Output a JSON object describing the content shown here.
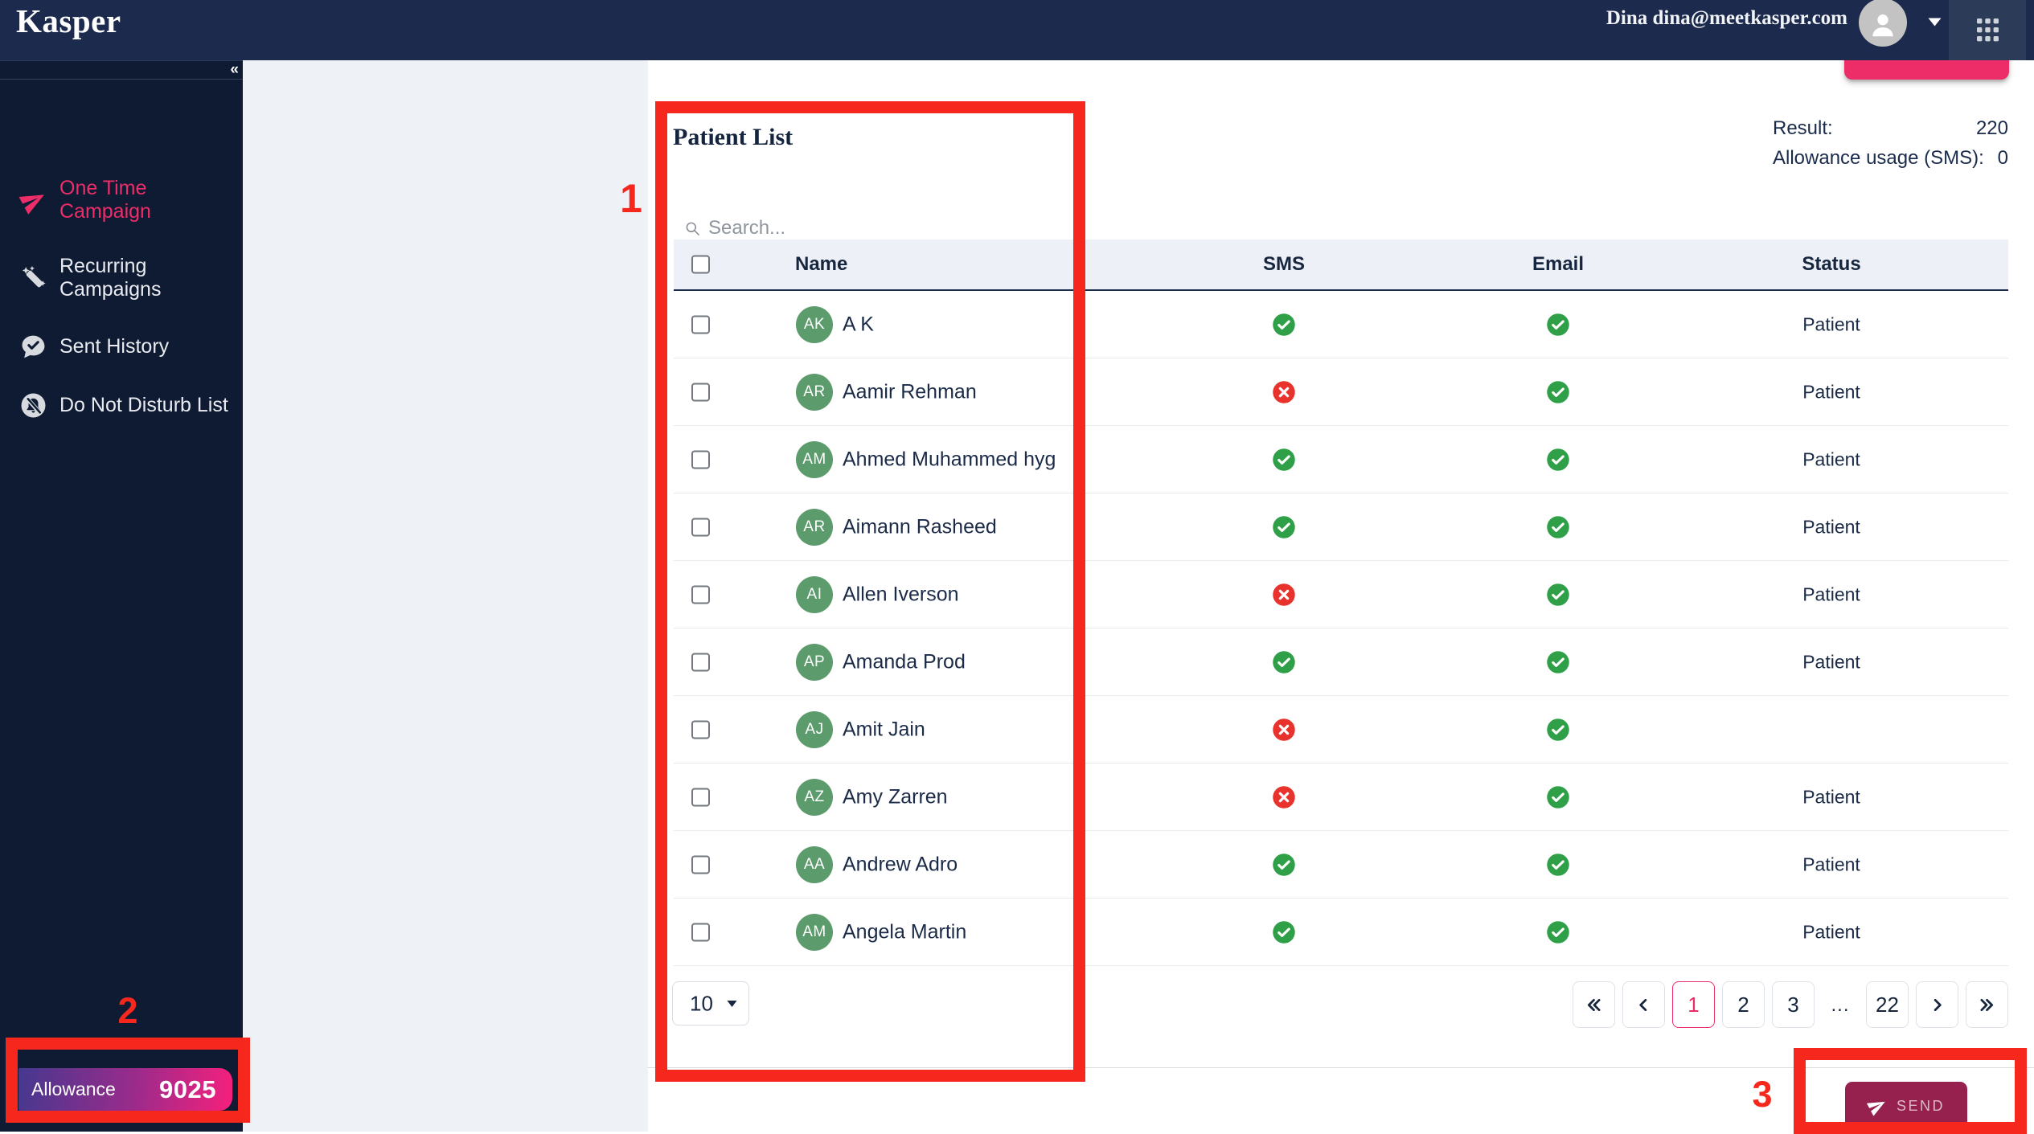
{
  "theme": {
    "header_bg": "#1c2b4d",
    "apps_bg": "#2b3b58",
    "sidebar_bg": "#0e1b33",
    "content_bg": "#eef1f6",
    "thead_bg": "#edf0f6",
    "navy_text": "#16263f",
    "accent_pink": "#ec2d68",
    "annotation_red": "#f6281e",
    "send_bg": "#97214e",
    "avatar_green": "#5c9b6c",
    "check_green": "#2fa048",
    "cancel_red": "#e8332d",
    "grad_start": "#45388f",
    "grad_mid": "#9c2b8b",
    "grad_end": "#f6207c"
  },
  "header": {
    "logo": "Kasper",
    "user": "Dina dina@meetkasper.com"
  },
  "sidebar": {
    "collapse_icon": "«",
    "items": [
      {
        "label": "One Time Campaign",
        "icon": "paper-plane-icon",
        "active": true
      },
      {
        "label": "Recurring Campaigns",
        "icon": "magic-wand-icon",
        "active": false
      },
      {
        "label": "Sent History",
        "icon": "chat-check-icon",
        "active": false
      },
      {
        "label": "Do Not Disturb List",
        "icon": "bell-slash-icon",
        "active": false
      }
    ],
    "allowance": {
      "label": "Allowance",
      "value": "9025"
    }
  },
  "main": {
    "title": "Patient List",
    "stats": [
      {
        "label": "Result:",
        "value": "220"
      },
      {
        "label": "Allowance usage (SMS):",
        "value": "0"
      }
    ],
    "search": {
      "placeholder": "Search..."
    },
    "table": {
      "columns": {
        "name": "Name",
        "sms": "SMS",
        "email": "Email",
        "status": "Status"
      },
      "rows": [
        {
          "initials": "AK",
          "name": "A K",
          "sms": true,
          "email": true,
          "status": "Patient"
        },
        {
          "initials": "AR",
          "name": "Aamir Rehman",
          "sms": false,
          "email": true,
          "status": "Patient"
        },
        {
          "initials": "AM",
          "name": "Ahmed Muhammed hyg",
          "sms": true,
          "email": true,
          "status": "Patient"
        },
        {
          "initials": "AR",
          "name": "Aimann Rasheed",
          "sms": true,
          "email": true,
          "status": "Patient"
        },
        {
          "initials": "AI",
          "name": "Allen Iverson",
          "sms": false,
          "email": true,
          "status": "Patient"
        },
        {
          "initials": "AP",
          "name": "Amanda Prod",
          "sms": true,
          "email": true,
          "status": "Patient"
        },
        {
          "initials": "AJ",
          "name": "Amit Jain",
          "sms": false,
          "email": true,
          "status": ""
        },
        {
          "initials": "AZ",
          "name": "Amy Zarren",
          "sms": false,
          "email": true,
          "status": "Patient"
        },
        {
          "initials": "AA",
          "name": "Andrew Adro",
          "sms": true,
          "email": true,
          "status": "Patient"
        },
        {
          "initials": "AM",
          "name": "Angela Martin",
          "sms": true,
          "email": true,
          "status": "Patient"
        }
      ]
    },
    "pagination": {
      "rows_per_page": "10",
      "items": [
        {
          "kind": "first",
          "icon": "chevrons-left-icon"
        },
        {
          "kind": "prev",
          "icon": "chevron-left-icon"
        },
        {
          "kind": "page",
          "label": "1",
          "active": true
        },
        {
          "kind": "page",
          "label": "2"
        },
        {
          "kind": "page",
          "label": "3"
        },
        {
          "kind": "ellipsis",
          "label": "..."
        },
        {
          "kind": "page",
          "label": "22"
        },
        {
          "kind": "next",
          "icon": "chevron-right-icon"
        },
        {
          "kind": "last",
          "icon": "chevrons-right-icon"
        }
      ]
    },
    "send_label": "SEND"
  },
  "annotations": [
    {
      "number": "1"
    },
    {
      "number": "2"
    },
    {
      "number": "3"
    }
  ]
}
